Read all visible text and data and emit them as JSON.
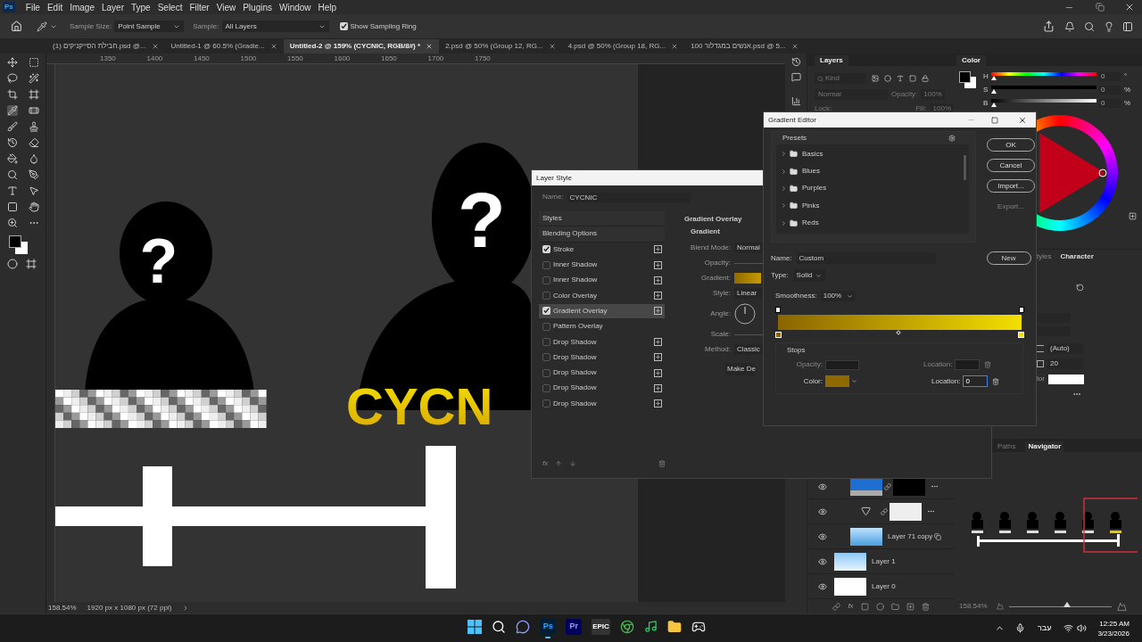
{
  "app_logo": "Ps",
  "menu_bar": {
    "items": [
      "File",
      "Edit",
      "Image",
      "Layer",
      "Type",
      "Select",
      "Filter",
      "View",
      "Plugins",
      "Window",
      "Help"
    ]
  },
  "options_bar": {
    "sample_size_label": "Sample Size:",
    "sample_size": "Point Sample",
    "sample_label": "Sample:",
    "sample": "All Layers",
    "sampling_ring": {
      "label": "Show Sampling Ring",
      "checked": true
    }
  },
  "document_tabs": [
    {
      "label": "חבילת הסייקניקים (1).psd @...",
      "selected": false
    },
    {
      "label": "Untitled-1 @ 60.5% (Gradie...",
      "selected": false
    },
    {
      "label": "Untitled-2 @ 159% (CYCNIC, RGB/8#) *",
      "selected": true
    },
    {
      "label": "2.psd @ 50% (Group 12, RG...",
      "selected": false
    },
    {
      "label": "4.psd @ 50% (Group 18, RG...",
      "selected": false
    },
    {
      "label": "100 אנשים במגדלור.psd @ 5...",
      "selected": false
    }
  ],
  "ruler": {
    "ticks": [
      "1350",
      "1400",
      "1450",
      "1500",
      "1550",
      "1600",
      "1650",
      "1700",
      "1750"
    ]
  },
  "canvas": {
    "figures": [
      {
        "mark": "?"
      },
      {
        "mark": "?"
      }
    ],
    "title_text": "CYCN"
  },
  "status_bar": {
    "zoom": "158.54%",
    "size": "1920 px x 1080 px (72 ppi)"
  },
  "layer_style": {
    "title": "Layer Style",
    "name_label": "Name:",
    "name": "CYCNIC",
    "styles": [
      {
        "label": "Styles",
        "kind": "header",
        "selected": false
      },
      {
        "label": "Blending Options",
        "kind": "header",
        "selected": false
      },
      {
        "label": "Stroke",
        "kind": "effect",
        "checked": true,
        "addable": true,
        "selected": false
      },
      {
        "label": "Inner Shadow",
        "kind": "effect",
        "checked": false,
        "addable": true,
        "selected": false
      },
      {
        "label": "Inner Shadow",
        "kind": "effect",
        "checked": false,
        "addable": true,
        "selected": false
      },
      {
        "label": "Color Overlay",
        "kind": "effect",
        "checked": false,
        "addable": true,
        "selected": false
      },
      {
        "label": "Gradient Overlay",
        "kind": "effect",
        "checked": true,
        "addable": true,
        "selected": true
      },
      {
        "label": "Pattern Overlay",
        "kind": "effect",
        "checked": false,
        "addable": false,
        "selected": false
      },
      {
        "label": "Drop Shadow",
        "kind": "effect",
        "checked": false,
        "addable": true,
        "selected": false
      },
      {
        "label": "Drop Shadow",
        "kind": "effect",
        "checked": false,
        "addable": true,
        "selected": false
      },
      {
        "label": "Drop Shadow",
        "kind": "effect",
        "checked": false,
        "addable": true,
        "selected": false
      },
      {
        "label": "Drop Shadow",
        "kind": "effect",
        "checked": false,
        "addable": true,
        "selected": false
      },
      {
        "label": "Drop Shadow",
        "kind": "effect",
        "checked": false,
        "addable": true,
        "selected": false
      }
    ],
    "section_title": "Gradient Overlay",
    "group_title": "Gradient",
    "fields": [
      {
        "label": "Blend Mode:",
        "kind": "select",
        "value": "Normal"
      },
      {
        "label": "Opacity:",
        "kind": "slider"
      },
      {
        "label": "Gradient:",
        "kind": "gradient"
      },
      {
        "label": "Style:",
        "kind": "select",
        "value": "Linear"
      },
      {
        "label": "Angle:",
        "kind": "angle"
      },
      {
        "label": "Scale:",
        "kind": "slider"
      },
      {
        "label": "Method:",
        "kind": "select",
        "value": "Classic"
      }
    ],
    "make_default_button": "Make De",
    "fx_label": "fx"
  },
  "gradient_editor": {
    "title": "Gradient Editor",
    "presets_label": "Presets",
    "presets": [
      {
        "label": "Basics"
      },
      {
        "label": "Blues"
      },
      {
        "label": "Purples"
      },
      {
        "label": "Pinks"
      },
      {
        "label": "Reds"
      }
    ],
    "buttons": [
      {
        "label": "OK",
        "disabled": false
      },
      {
        "label": "Cancel",
        "disabled": false
      },
      {
        "label": "Import...",
        "disabled": false
      },
      {
        "label": "Export...",
        "disabled": true
      }
    ],
    "name_label": "Name:",
    "name": "Custom",
    "new_button": "New",
    "type_label": "Type:",
    "type": "Solid",
    "smoothness_label": "Smoothness:",
    "smoothness": "100%",
    "stops": [
      {
        "color": "#8a6400"
      },
      {
        "color": "#f3e000"
      }
    ],
    "stops_label": "Stops",
    "opacity_label": "Opacity:",
    "opacity_location_label": "Location:",
    "opacity_disabled": true,
    "color_label": "Color:",
    "color": "#8f6a00",
    "location_label": "Location:",
    "location": "0"
  },
  "layers_panel": {
    "tab": "Layers",
    "kind_placeholder": "Kind",
    "blend_mode": "Normal",
    "opacity_label": "Opacity:",
    "opacity": "100%",
    "lock_label": "Lock:",
    "fill_label": "Fill:",
    "fill": "100%",
    "fx_label": "fx",
    "layers": [
      {
        "kind": "image_mask"
      },
      {
        "kind": "adjustment_mask"
      },
      {
        "kind": "smart",
        "name": "Layer 71 copy"
      },
      {
        "kind": "sky",
        "name": "Layer 1"
      },
      {
        "kind": "white",
        "name": "Layer 0"
      }
    ]
  },
  "color_panel": {
    "tab": "Color",
    "sliders": [
      {
        "label": "H",
        "value": "0",
        "unit": "°",
        "level": 0
      },
      {
        "label": "S",
        "value": "0",
        "unit": "%",
        "level": 0
      },
      {
        "label": "B",
        "value": "0",
        "unit": "%",
        "level": 0
      }
    ]
  },
  "character_panel": {
    "tabs": [
      {
        "label": "tyles",
        "selected": false
      },
      {
        "label": "Character",
        "selected": true
      }
    ],
    "leading": "(Auto)",
    "tracking": "20",
    "color_label": "lor"
  },
  "navigator_panel": {
    "tabs": [
      {
        "label": "Paths",
        "selected": false
      },
      {
        "label": "Navigator",
        "selected": true
      }
    ],
    "zoom": "158.54%",
    "zoom_slider": {
      "level": 0.55
    }
  },
  "taskbar": {
    "apps": [
      {
        "kind": "start",
        "selected": false
      },
      {
        "kind": "search",
        "selected": false
      },
      {
        "kind": "chat",
        "selected": false
      },
      {
        "kind": "ps",
        "label": "Ps",
        "selected": true
      },
      {
        "kind": "pr",
        "label": "Pr",
        "selected": false
      },
      {
        "kind": "epic",
        "label": "EPIC",
        "selected": false
      },
      {
        "kind": "browser",
        "selected": false
      },
      {
        "kind": "music",
        "selected": false
      },
      {
        "kind": "folder",
        "selected": false
      },
      {
        "kind": "game",
        "selected": false
      }
    ],
    "language": "עבר",
    "time": "12:25 AM",
    "date": "3/23/2026"
  }
}
